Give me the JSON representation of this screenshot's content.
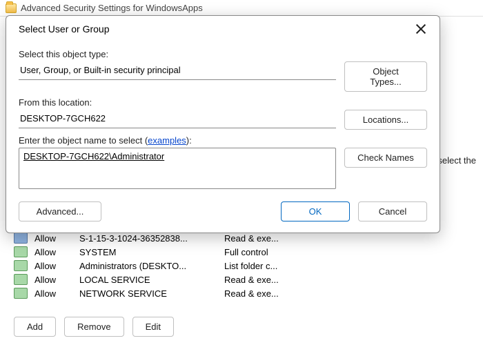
{
  "parent": {
    "title": "Advanced Security Settings for WindowsApps",
    "hint_fragment": ", select the"
  },
  "dialog": {
    "title": "Select User or Group",
    "close_aria": "Close",
    "object_type_label": "Select this object type:",
    "object_type_value": "User, Group, or Built-in security principal",
    "object_types_btn": "Object Types...",
    "location_label": "From this location:",
    "location_value": "DESKTOP-7GCH622",
    "locations_btn": "Locations...",
    "enter_name_prefix": "Enter the object name to select (",
    "examples_link": "examples",
    "enter_name_suffix": "):",
    "object_name_value": "DESKTOP-7GCH622\\Administrator",
    "check_names_btn": "Check Names",
    "advanced_btn": "Advanced...",
    "ok_btn": "OK",
    "cancel_btn": "Cancel"
  },
  "permissions": {
    "rows": [
      {
        "type": "Allow",
        "principal": "S-1-15-3-1024-36352838...",
        "access": "Read & exe..."
      },
      {
        "type": "Allow",
        "principal": "SYSTEM",
        "access": "Full control"
      },
      {
        "type": "Allow",
        "principal": "Administrators (DESKTO...",
        "access": "List folder c..."
      },
      {
        "type": "Allow",
        "principal": "LOCAL SERVICE",
        "access": "Read & exe..."
      },
      {
        "type": "Allow",
        "principal": "NETWORK SERVICE",
        "access": "Read & exe..."
      }
    ],
    "add_btn": "Add",
    "remove_btn": "Remove",
    "edit_btn": "Edit"
  }
}
